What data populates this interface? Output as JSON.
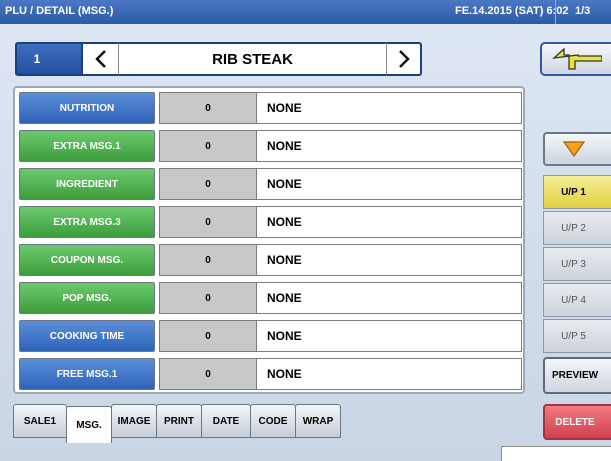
{
  "titlebar": {
    "title": "PLU / DETAIL (MSG.)",
    "datetime": "FE.14.2015 (SAT)  6:02",
    "page": "1/3"
  },
  "plu": {
    "number": "1",
    "name": "RIB STEAK",
    "prev_icon": "chevron-left-icon",
    "next_icon": "chevron-right-icon"
  },
  "side": {
    "back_icon": "return-arrow-icon",
    "down_icon": "triangle-down-icon",
    "unit_prices": [
      "U/P 1",
      "U/P 2",
      "U/P 3",
      "U/P 4",
      "U/P 5"
    ],
    "active_unit_price": "U/P 1",
    "preview_label": "PREVIEW",
    "delete_label": "DELETE"
  },
  "messages": [
    {
      "label": "NUTRITION",
      "value": "0",
      "text": "NONE",
      "color": "blue"
    },
    {
      "label": "EXTRA MSG.1",
      "value": "0",
      "text": "NONE",
      "color": "green"
    },
    {
      "label": "INGREDIENT",
      "value": "0",
      "text": "NONE",
      "color": "green"
    },
    {
      "label": "EXTRA MSG.3",
      "value": "0",
      "text": "NONE",
      "color": "green"
    },
    {
      "label": "COUPON MSG.",
      "value": "0",
      "text": "NONE",
      "color": "green"
    },
    {
      "label": "POP MSG.",
      "value": "0",
      "text": "NONE",
      "color": "green"
    },
    {
      "label": "COOKING TIME",
      "value": "0",
      "text": "NONE",
      "color": "blue"
    },
    {
      "label": "FREE MSG.1",
      "value": "0",
      "text": "NONE",
      "color": "blue"
    }
  ],
  "tabs": [
    "SALE1",
    "MSG.",
    "IMAGE",
    "PRINT",
    "DATE",
    "CODE",
    "WRAP"
  ],
  "active_tab": "MSG.",
  "colors": {
    "title_blue": "#2d5aa8",
    "label_blue": "#2f63b8",
    "label_green": "#3d9d3d",
    "active_yellow": "#e0cf3e",
    "delete_red": "#d1404e"
  }
}
